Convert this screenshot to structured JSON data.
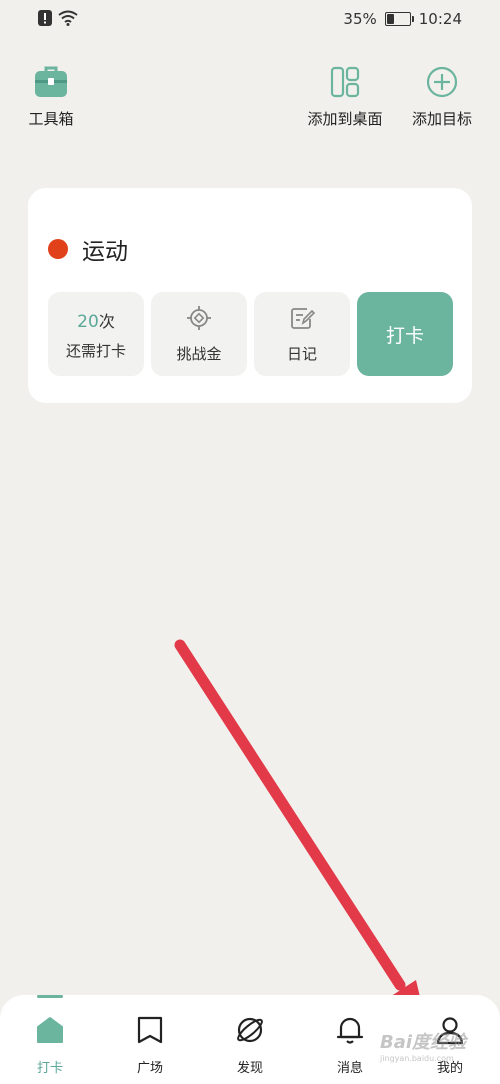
{
  "status_bar": {
    "battery_percent": "35%",
    "battery_level": 0.35,
    "time": "10:24"
  },
  "toolbar": {
    "toolbox_label": "工具箱",
    "add_to_desktop_label": "添加到桌面",
    "add_goal_label": "添加目标"
  },
  "habit_card": {
    "title": "运动",
    "dot_color": "#e0401a",
    "remaining_value": "20",
    "remaining_unit": "次",
    "remaining_label": "还需打卡",
    "challenge_label": "挑战金",
    "diary_label": "日记",
    "checkin_button": "打卡"
  },
  "bottom_nav": {
    "items": [
      {
        "label": "打卡",
        "icon": "home-icon",
        "active": true
      },
      {
        "label": "广场",
        "icon": "bookmark-icon",
        "active": false
      },
      {
        "label": "发现",
        "icon": "planet-icon",
        "active": false
      },
      {
        "label": "消息",
        "icon": "bell-icon",
        "active": false
      },
      {
        "label": "我的",
        "icon": "person-icon",
        "active": false
      }
    ]
  },
  "colors": {
    "accent": "#6bb49e",
    "background": "#f1f0ec",
    "arrow": "#e23a48"
  },
  "watermark": {
    "text": "Bai度经验",
    "subtext": "jingyan.baidu.com"
  }
}
